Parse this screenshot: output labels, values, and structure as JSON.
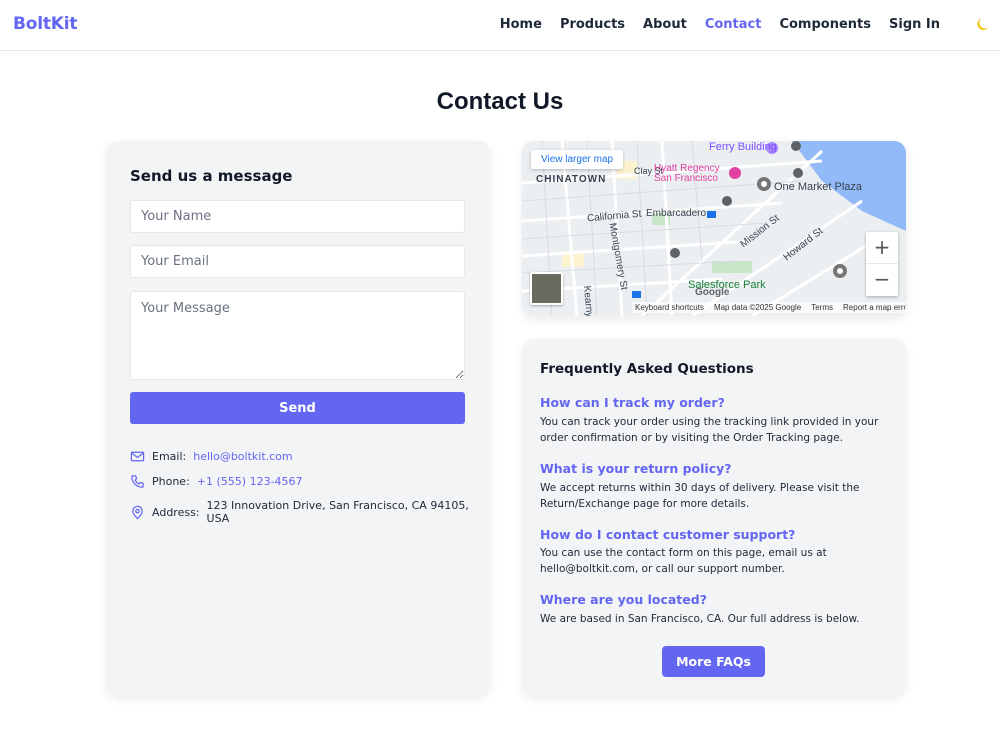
{
  "header": {
    "brand": "BoltKit",
    "nav": [
      {
        "label": "Home",
        "active": false
      },
      {
        "label": "Products",
        "active": false
      },
      {
        "label": "About",
        "active": false
      },
      {
        "label": "Contact",
        "active": true
      },
      {
        "label": "Components",
        "active": false
      },
      {
        "label": "Sign In",
        "active": false
      }
    ],
    "theme_icon": "moon-icon"
  },
  "page": {
    "title": "Contact Us"
  },
  "contact_form": {
    "heading": "Send us a message",
    "name_placeholder": "Your Name",
    "email_placeholder": "Your Email",
    "message_placeholder": "Your Message",
    "send_label": "Send"
  },
  "contact_info": {
    "email_label": "Email:",
    "email_value": "hello@boltkit.com",
    "phone_label": "Phone:",
    "phone_value": "+1 (555) 123-4567",
    "address_label": "Address:",
    "address_value": "123 Innovation Drive, San Francisco, CA 94105, USA"
  },
  "map": {
    "view_larger": "View larger map",
    "labels": {
      "ferry_building": "Ferry Building",
      "chinatown": "CHINATOWN",
      "clay_st": "Clay St",
      "hyatt": "Hyatt Regency",
      "hyatt_city": "San Francisco",
      "one_market": "One Market Plaza",
      "california_st": "California St",
      "embarcadero": "Embarcadero",
      "montgomery_st": "Montgomery St",
      "mission_st": "Mission St",
      "howard_st": "Howard St",
      "salesforce_park": "Salesforce Park",
      "kearny": "Kearny",
      "google": "Google"
    },
    "zoom_in": "+",
    "zoom_out": "−",
    "footer": {
      "shortcuts": "Keyboard shortcuts",
      "data": "Map data ©2025 Google",
      "terms": "Terms",
      "report": "Report a map error"
    }
  },
  "faq": {
    "heading": "Frequently Asked Questions",
    "items": [
      {
        "q": "How can I track my order?",
        "a": "You can track your order using the tracking link provided in your order confirmation or by visiting the Order Tracking page."
      },
      {
        "q": "What is your return policy?",
        "a": "We accept returns within 30 days of delivery. Please visit the Return/Exchange page for more details."
      },
      {
        "q": "How do I contact customer support?",
        "a": "You can use the contact form on this page, email us at hello@boltkit.com, or call our support number."
      },
      {
        "q": "Where are you located?",
        "a": "We are based in San Francisco, CA. Our full address is below."
      }
    ],
    "more_label": "More FAQs"
  },
  "colors": {
    "accent": "#6366f1",
    "card_bg": "#f3f4f6"
  }
}
